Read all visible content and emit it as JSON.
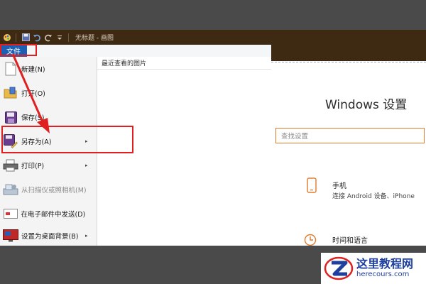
{
  "titlebar": {
    "title": "无标题 - 画图"
  },
  "file_tab": {
    "label": "文件"
  },
  "menu": {
    "items": [
      {
        "label": "新建(N)",
        "has_submenu": false,
        "enabled": true,
        "icon": "new-file-icon"
      },
      {
        "label": "打开(O)",
        "has_submenu": false,
        "enabled": true,
        "icon": "open-folder-icon"
      },
      {
        "label": "保存(S)",
        "has_submenu": false,
        "enabled": true,
        "icon": "save-icon"
      },
      {
        "label": "另存为(A)",
        "has_submenu": true,
        "enabled": true,
        "icon": "save-as-icon"
      },
      {
        "label": "打印(P)",
        "has_submenu": true,
        "enabled": true,
        "icon": "printer-icon"
      },
      {
        "label": "从扫描仪或照相机(M)",
        "has_submenu": false,
        "enabled": false,
        "icon": "scanner-icon"
      },
      {
        "label": "在电子邮件中发送(D)",
        "has_submenu": false,
        "enabled": true,
        "icon": "email-icon"
      },
      {
        "label": "设置为桌面背景(B)",
        "has_submenu": true,
        "enabled": true,
        "icon": "desktop-background-icon"
      }
    ],
    "recent_header": "最近查看的图片",
    "submenu_arrow": "▸"
  },
  "settings_window": {
    "title": "Windows 设置",
    "search_placeholder": "查找设置",
    "phone_title": "手机",
    "phone_desc": "连接 Android 设备、iPhone",
    "time_title": "时间和语言"
  },
  "watermark": {
    "name": "这里教程网",
    "url": "herecours.com"
  },
  "colors": {
    "file_tab": "#1e5fb3",
    "annotation_red": "#e02020",
    "titlebar": "#3e2a12",
    "accent_orange": "#e07b2e",
    "watermark_blue": "#1e3f9e"
  }
}
